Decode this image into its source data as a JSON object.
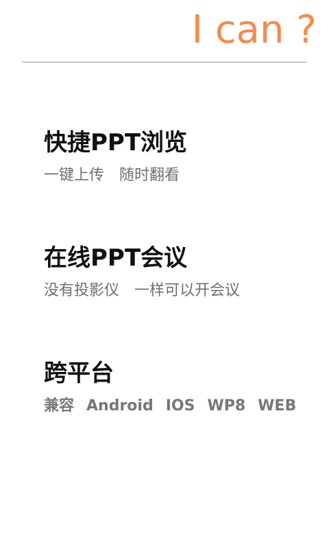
{
  "header": {
    "title": "I can ?"
  },
  "features": [
    {
      "title": "快捷PPT浏览",
      "description_parts": [
        "一键上传",
        "随时翻看"
      ]
    },
    {
      "title": "在线PPT会议",
      "description_parts": [
        "没有投影仪",
        "一样可以开会议"
      ]
    },
    {
      "title": "跨平台",
      "description_parts": [
        "兼容",
        "Android",
        "IOS",
        "WP8",
        "WEB"
      ]
    }
  ],
  "colors": {
    "accent": "#f58b4c",
    "title": "#111111",
    "text": "#6f6f6f",
    "divider": "#9a9a9a"
  }
}
